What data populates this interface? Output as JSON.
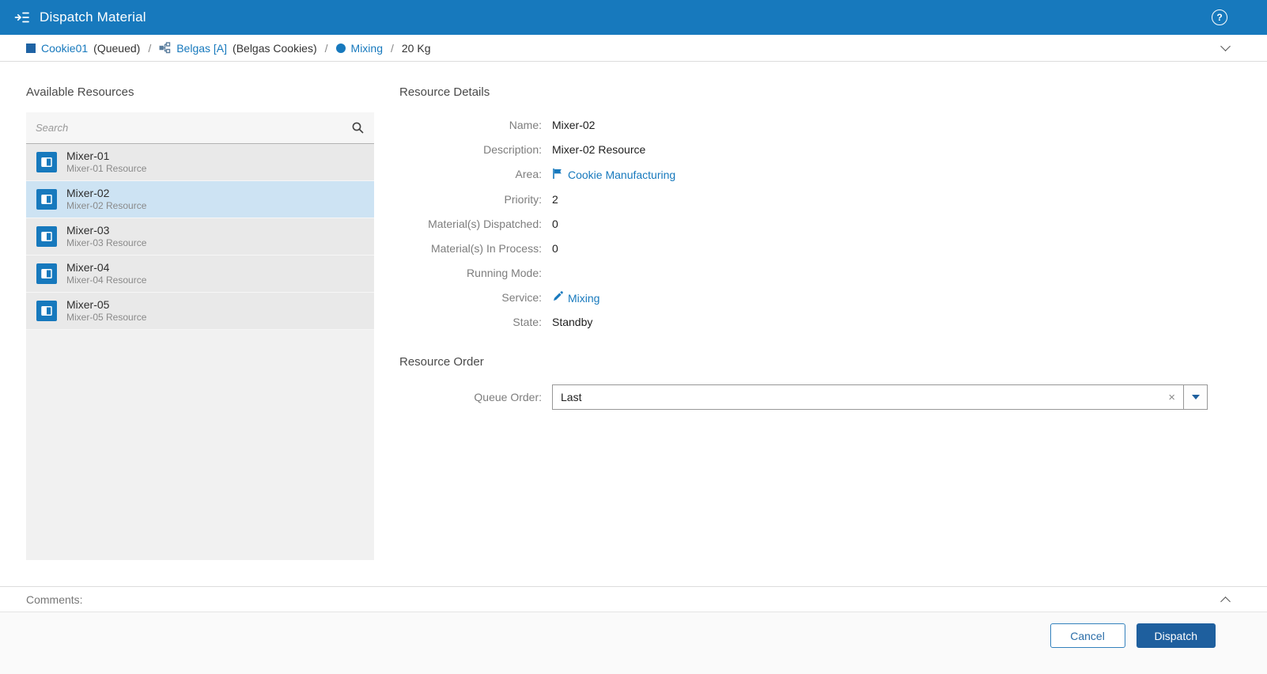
{
  "header": {
    "title": "Dispatch Material",
    "help_glyph": "?"
  },
  "breadcrumb": {
    "material_label": "Cookie01",
    "material_state": "(Queued)",
    "separator": "/",
    "order_label": "Belgas [A]",
    "order_description": "(Belgas Cookies)",
    "step_label": "Mixing",
    "quantity": "20 Kg"
  },
  "resources": {
    "heading": "Available Resources",
    "search_placeholder": "Search",
    "items": [
      {
        "name": "Mixer-01",
        "description": "Mixer-01 Resource",
        "selected": false
      },
      {
        "name": "Mixer-02",
        "description": "Mixer-02 Resource",
        "selected": true
      },
      {
        "name": "Mixer-03",
        "description": "Mixer-03 Resource",
        "selected": false
      },
      {
        "name": "Mixer-04",
        "description": "Mixer-04 Resource",
        "selected": false
      },
      {
        "name": "Mixer-05",
        "description": "Mixer-05 Resource",
        "selected": false
      }
    ]
  },
  "details": {
    "heading": "Resource Details",
    "rows": [
      {
        "label": "Name:",
        "value": "Mixer-02"
      },
      {
        "label": "Description:",
        "value": "Mixer-02 Resource"
      },
      {
        "label": "Area:",
        "value": "Cookie Manufacturing"
      },
      {
        "label": "Priority:",
        "value": "2"
      },
      {
        "label": "Material(s) Dispatched:",
        "value": "0"
      },
      {
        "label": "Material(s) In Process:",
        "value": "0"
      },
      {
        "label": "Running Mode:",
        "value": ""
      },
      {
        "label": "Service:",
        "value": "Mixing"
      },
      {
        "label": "State:",
        "value": "Standby"
      }
    ]
  },
  "order": {
    "heading": "Resource Order",
    "queue_label": "Queue Order:",
    "queue_value": "Last",
    "clear_glyph": "×"
  },
  "comments": {
    "label": "Comments:"
  },
  "footer": {
    "cancel_label": "Cancel",
    "dispatch_label": "Dispatch"
  },
  "colors": {
    "accent": "#1779bd",
    "header_bg": "#1779bd",
    "selected_row": "#cde3f3",
    "dispatch_button": "#1e5f9e"
  }
}
